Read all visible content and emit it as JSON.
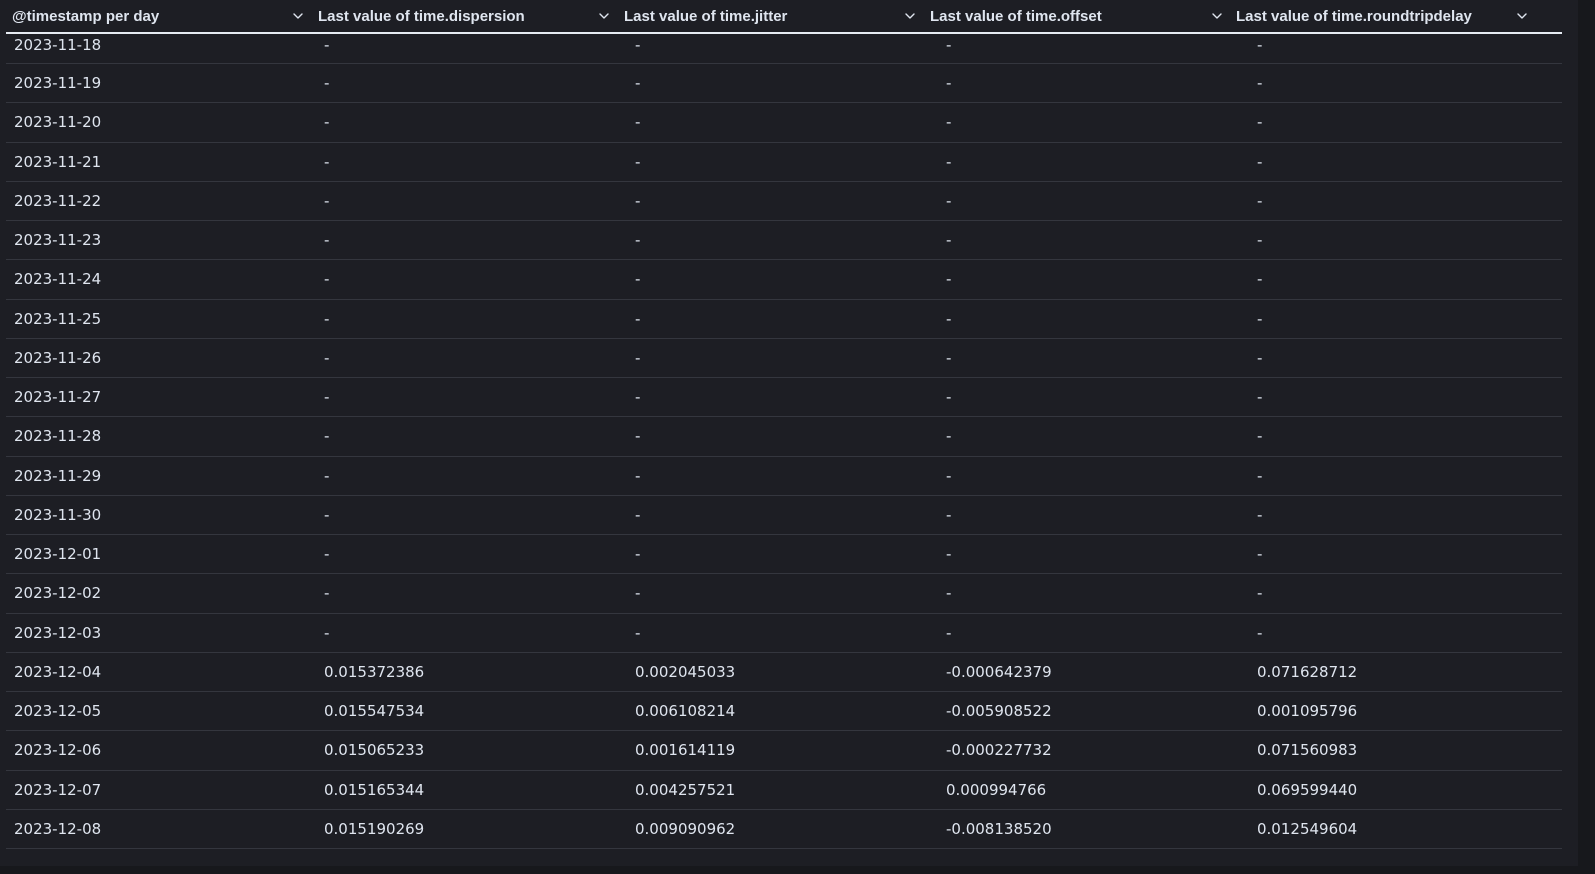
{
  "table": {
    "columns": [
      {
        "label": "@timestamp per day"
      },
      {
        "label": "Last value of time.dispersion"
      },
      {
        "label": "Last value of time.jitter"
      },
      {
        "label": "Last value of time.offset"
      },
      {
        "label": "Last value of time.roundtripdelay"
      }
    ],
    "rows": [
      [
        "2023-11-18",
        "-",
        "-",
        "-",
        "-"
      ],
      [
        "2023-11-19",
        "-",
        "-",
        "-",
        "-"
      ],
      [
        "2023-11-20",
        "-",
        "-",
        "-",
        "-"
      ],
      [
        "2023-11-21",
        "-",
        "-",
        "-",
        "-"
      ],
      [
        "2023-11-22",
        "-",
        "-",
        "-",
        "-"
      ],
      [
        "2023-11-23",
        "-",
        "-",
        "-",
        "-"
      ],
      [
        "2023-11-24",
        "-",
        "-",
        "-",
        "-"
      ],
      [
        "2023-11-25",
        "-",
        "-",
        "-",
        "-"
      ],
      [
        "2023-11-26",
        "-",
        "-",
        "-",
        "-"
      ],
      [
        "2023-11-27",
        "-",
        "-",
        "-",
        "-"
      ],
      [
        "2023-11-28",
        "-",
        "-",
        "-",
        "-"
      ],
      [
        "2023-11-29",
        "-",
        "-",
        "-",
        "-"
      ],
      [
        "2023-11-30",
        "-",
        "-",
        "-",
        "-"
      ],
      [
        "2023-12-01",
        "-",
        "-",
        "-",
        "-"
      ],
      [
        "2023-12-02",
        "-",
        "-",
        "-",
        "-"
      ],
      [
        "2023-12-03",
        "-",
        "-",
        "-",
        "-"
      ],
      [
        "2023-12-04",
        "0.015372386",
        "0.002045033",
        "-0.000642379",
        "0.071628712"
      ],
      [
        "2023-12-05",
        "0.015547534",
        "0.006108214",
        "-0.005908522",
        "0.001095796"
      ],
      [
        "2023-12-06",
        "0.015065233",
        "0.001614119",
        "-0.000227732",
        "0.071560983"
      ],
      [
        "2023-12-07",
        "0.015165344",
        "0.004257521",
        "0.000994766",
        "0.069599440"
      ],
      [
        "2023-12-08",
        "0.015190269",
        "0.009090962",
        "-0.008138520",
        "0.012549604"
      ]
    ]
  },
  "colors": {
    "background": "#1d1e24",
    "text": "#dfe5ef",
    "row_border": "#34363e",
    "header_border": "#e6ebf2"
  },
  "icons": {
    "column_menu": "chevron-down-icon"
  }
}
